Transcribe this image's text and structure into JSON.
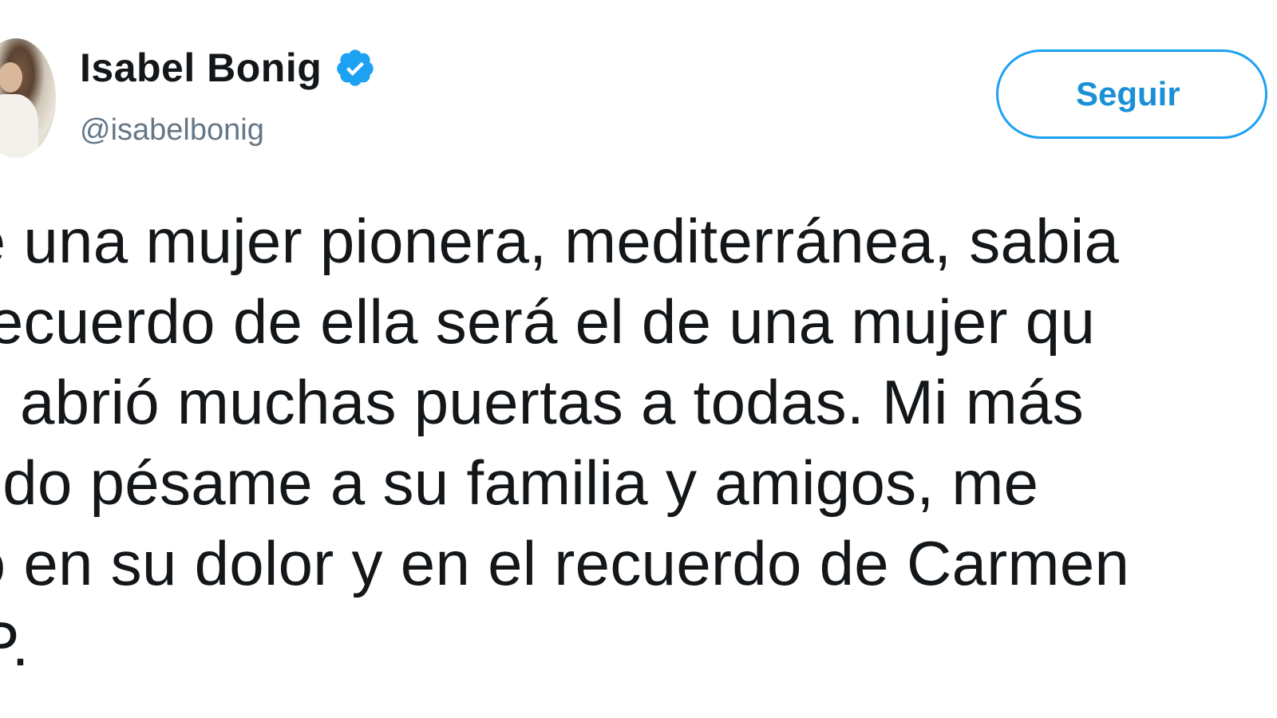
{
  "author": {
    "name": "Isabel Bonig",
    "handle": "@isabelbonig",
    "verified_icon": "verified-badge-icon"
  },
  "follow_button": {
    "label": "Seguir"
  },
  "tweet": {
    "lines": [
      "ue una mujer pionera, mediterránea, sabia",
      "i recuerdo de ella será el de una mujer qu",
      "os abrió muchas puertas a todas. Mi más",
      "ntido pésame a su familia y amigos, me",
      "no en su dolor y en el recuerdo de Carmen",
      "EP."
    ]
  },
  "colors": {
    "accent": "#1da1f2",
    "text": "#14171a",
    "secondary_text": "#657786",
    "background": "#ffffff"
  }
}
